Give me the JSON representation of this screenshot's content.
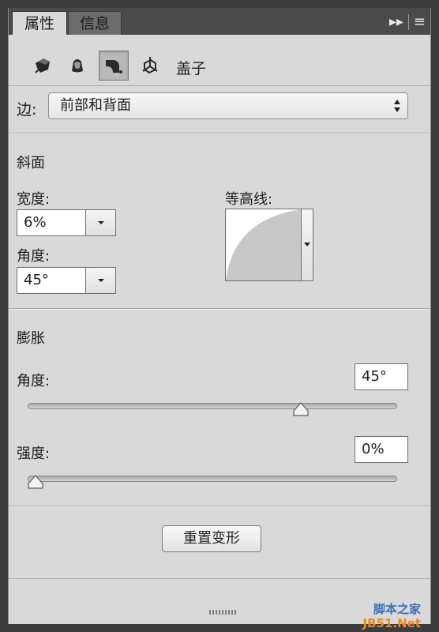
{
  "tabs": [
    {
      "label": "属性",
      "active": true
    },
    {
      "label": "信息",
      "active": false
    }
  ],
  "tabbar": {
    "expand_glyph": "▸▸",
    "menu_glyph": "≡"
  },
  "toolbar": {
    "icons": [
      "mesh-icon",
      "deform-icon",
      "cap-icon",
      "coordinates-icon"
    ],
    "selected_index": 2,
    "title": "盖子"
  },
  "side": {
    "label": "边:",
    "value": "前部和背面"
  },
  "bevel": {
    "title": "斜面",
    "width_label": "宽度:",
    "width_value": "6%",
    "angle_label": "角度:",
    "angle_value": "45°",
    "contour_label": "等高线:"
  },
  "inflate": {
    "title": "膨胀",
    "angle_label": "角度:",
    "angle_value": "45°",
    "angle_slider_fraction": 0.75,
    "strength_label": "强度:",
    "strength_value": "0%",
    "strength_slider_fraction": 0.0
  },
  "reset_button": "重置变形",
  "watermark": {
    "line1": "脚本之家",
    "line2": "JB51.Net"
  }
}
